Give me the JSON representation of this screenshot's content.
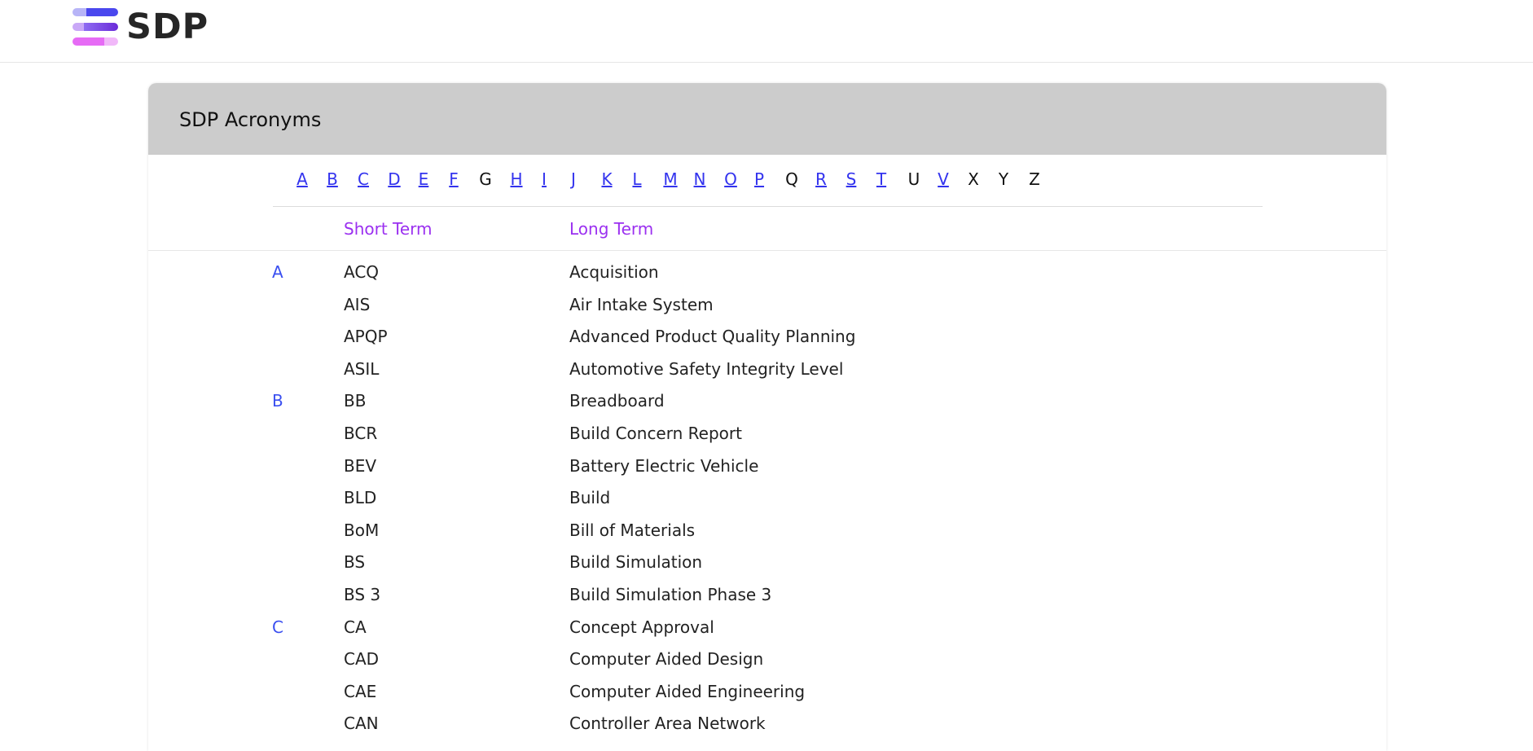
{
  "header": {
    "logo_text": "SDP",
    "logo_colors": [
      "#4a47ee",
      "#8f6cf2",
      "#e66bf5"
    ]
  },
  "card": {
    "title": "SDP Acronyms"
  },
  "letters": [
    {
      "char": "A",
      "link": true
    },
    {
      "char": "B",
      "link": true
    },
    {
      "char": "C",
      "link": true
    },
    {
      "char": "D",
      "link": true
    },
    {
      "char": "E",
      "link": true
    },
    {
      "char": "F",
      "link": true
    },
    {
      "char": "G",
      "link": false
    },
    {
      "char": "H",
      "link": true
    },
    {
      "char": "I",
      "link": true
    },
    {
      "char": "J",
      "link": true
    },
    {
      "char": "K",
      "link": true
    },
    {
      "char": "L",
      "link": true
    },
    {
      "char": "M",
      "link": true
    },
    {
      "char": "N",
      "link": true
    },
    {
      "char": "O",
      "link": true
    },
    {
      "char": "P",
      "link": true
    },
    {
      "char": "Q",
      "link": false
    },
    {
      "char": "R",
      "link": true
    },
    {
      "char": "S",
      "link": true
    },
    {
      "char": "T",
      "link": true
    },
    {
      "char": "U",
      "link": false
    },
    {
      "char": "V",
      "link": true
    },
    {
      "char": "X",
      "link": false
    },
    {
      "char": "Y",
      "link": false
    },
    {
      "char": "Z",
      "link": false
    }
  ],
  "columns": {
    "short": "Short Term",
    "long": "Long Term"
  },
  "rows": [
    {
      "group": "A",
      "short": "ACQ",
      "long": "Acquisition"
    },
    {
      "group": "",
      "short": "AIS",
      "long": "Air Intake System"
    },
    {
      "group": "",
      "short": "APQP",
      "long": "Advanced Product Quality Planning"
    },
    {
      "group": "",
      "short": "ASIL",
      "long": "Automotive Safety Integrity Level"
    },
    {
      "group": "B",
      "short": "BB",
      "long": "Breadboard"
    },
    {
      "group": "",
      "short": "BCR",
      "long": "Build Concern Report"
    },
    {
      "group": "",
      "short": "BEV",
      "long": "Battery Electric Vehicle"
    },
    {
      "group": "",
      "short": "BLD",
      "long": "Build"
    },
    {
      "group": "",
      "short": "BoM",
      "long": "Bill of Materials"
    },
    {
      "group": "",
      "short": "BS",
      "long": "Build Simulation"
    },
    {
      "group": "",
      "short": "BS 3",
      "long": "Build Simulation Phase 3"
    },
    {
      "group": "C",
      "short": "CA",
      "long": "Concept Approval"
    },
    {
      "group": "",
      "short": "CAD",
      "long": "Computer Aided Design"
    },
    {
      "group": "",
      "short": "CAE",
      "long": "Computer Aided Engineering"
    },
    {
      "group": "",
      "short": "CAN",
      "long": "Controller Area Network"
    }
  ]
}
